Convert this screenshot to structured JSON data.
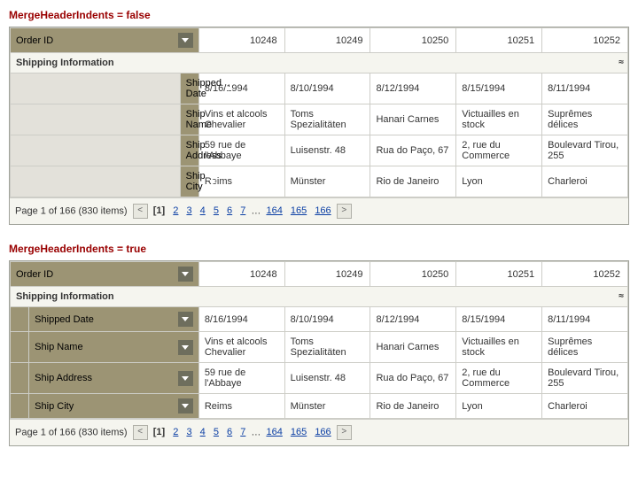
{
  "titles": {
    "a": "MergeHeaderIndents = false",
    "b": "MergeHeaderIndents = true"
  },
  "headers": {
    "orderId": "Order ID",
    "group": "Shipping Information",
    "fields": {
      "date": "Shipped Date",
      "name": "Ship Name",
      "addr": "Ship Address",
      "city": "Ship City"
    }
  },
  "orders": {
    "c0": "10248",
    "c1": "10249",
    "c2": "10250",
    "c3": "10251",
    "c4": "10252"
  },
  "rows": {
    "date": {
      "c0": "8/16/1994",
      "c1": "8/10/1994",
      "c2": "8/12/1994",
      "c3": "8/15/1994",
      "c4": "8/11/1994"
    },
    "name": {
      "c0": "Vins et alcools Chevalier",
      "c1": "Toms Spezialitäten",
      "c2": "Hanari Carnes",
      "c3": "Victuailles en stock",
      "c4": "Suprêmes délices"
    },
    "addr": {
      "c0": "59 rue de l'Abbaye",
      "c1": "Luisenstr. 48",
      "c2": "Rua do Paço, 67",
      "c3": "2, rue du Commerce",
      "c4": "Boulevard Tirou, 255"
    },
    "city": {
      "c0": "Reims",
      "c1": "Münster",
      "c2": "Rio de Janeiro",
      "c3": "Lyon",
      "c4": "Charleroi"
    }
  },
  "pager": {
    "summary": "Page 1 of 166 (830 items)",
    "current": "[1]",
    "p2": "2",
    "p3": "3",
    "p4": "4",
    "p5": "5",
    "p6": "6",
    "p7": "7",
    "ellipsis": "…",
    "p164": "164",
    "p165": "165",
    "p166": "166",
    "prev": "<",
    "next": ">"
  },
  "collapse": "≈"
}
